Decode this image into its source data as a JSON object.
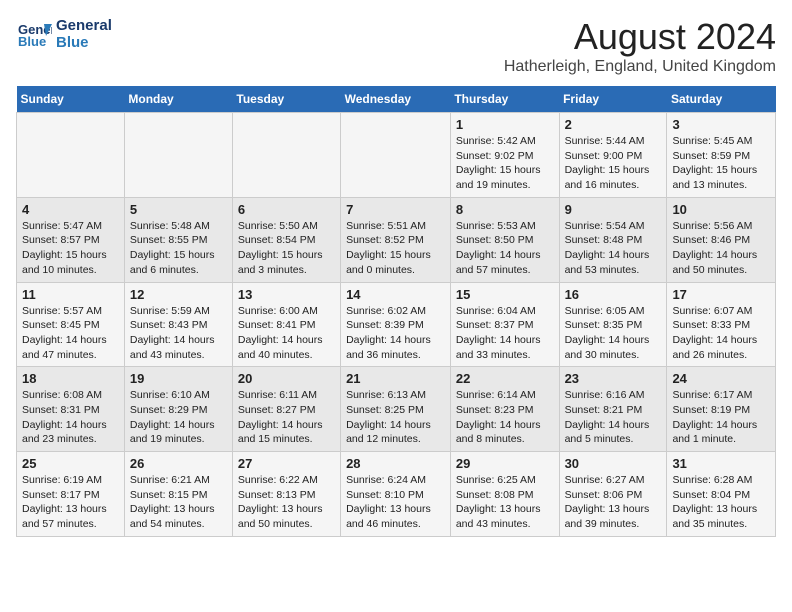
{
  "header": {
    "logo_line1": "General",
    "logo_line2": "Blue",
    "month": "August 2024",
    "location": "Hatherleigh, England, United Kingdom"
  },
  "days_of_week": [
    "Sunday",
    "Monday",
    "Tuesday",
    "Wednesday",
    "Thursday",
    "Friday",
    "Saturday"
  ],
  "weeks": [
    [
      {
        "day": "",
        "info": ""
      },
      {
        "day": "",
        "info": ""
      },
      {
        "day": "",
        "info": ""
      },
      {
        "day": "",
        "info": ""
      },
      {
        "day": "1",
        "info": "Sunrise: 5:42 AM\nSunset: 9:02 PM\nDaylight: 15 hours\nand 19 minutes."
      },
      {
        "day": "2",
        "info": "Sunrise: 5:44 AM\nSunset: 9:00 PM\nDaylight: 15 hours\nand 16 minutes."
      },
      {
        "day": "3",
        "info": "Sunrise: 5:45 AM\nSunset: 8:59 PM\nDaylight: 15 hours\nand 13 minutes."
      }
    ],
    [
      {
        "day": "4",
        "info": "Sunrise: 5:47 AM\nSunset: 8:57 PM\nDaylight: 15 hours\nand 10 minutes."
      },
      {
        "day": "5",
        "info": "Sunrise: 5:48 AM\nSunset: 8:55 PM\nDaylight: 15 hours\nand 6 minutes."
      },
      {
        "day": "6",
        "info": "Sunrise: 5:50 AM\nSunset: 8:54 PM\nDaylight: 15 hours\nand 3 minutes."
      },
      {
        "day": "7",
        "info": "Sunrise: 5:51 AM\nSunset: 8:52 PM\nDaylight: 15 hours\nand 0 minutes."
      },
      {
        "day": "8",
        "info": "Sunrise: 5:53 AM\nSunset: 8:50 PM\nDaylight: 14 hours\nand 57 minutes."
      },
      {
        "day": "9",
        "info": "Sunrise: 5:54 AM\nSunset: 8:48 PM\nDaylight: 14 hours\nand 53 minutes."
      },
      {
        "day": "10",
        "info": "Sunrise: 5:56 AM\nSunset: 8:46 PM\nDaylight: 14 hours\nand 50 minutes."
      }
    ],
    [
      {
        "day": "11",
        "info": "Sunrise: 5:57 AM\nSunset: 8:45 PM\nDaylight: 14 hours\nand 47 minutes."
      },
      {
        "day": "12",
        "info": "Sunrise: 5:59 AM\nSunset: 8:43 PM\nDaylight: 14 hours\nand 43 minutes."
      },
      {
        "day": "13",
        "info": "Sunrise: 6:00 AM\nSunset: 8:41 PM\nDaylight: 14 hours\nand 40 minutes."
      },
      {
        "day": "14",
        "info": "Sunrise: 6:02 AM\nSunset: 8:39 PM\nDaylight: 14 hours\nand 36 minutes."
      },
      {
        "day": "15",
        "info": "Sunrise: 6:04 AM\nSunset: 8:37 PM\nDaylight: 14 hours\nand 33 minutes."
      },
      {
        "day": "16",
        "info": "Sunrise: 6:05 AM\nSunset: 8:35 PM\nDaylight: 14 hours\nand 30 minutes."
      },
      {
        "day": "17",
        "info": "Sunrise: 6:07 AM\nSunset: 8:33 PM\nDaylight: 14 hours\nand 26 minutes."
      }
    ],
    [
      {
        "day": "18",
        "info": "Sunrise: 6:08 AM\nSunset: 8:31 PM\nDaylight: 14 hours\nand 23 minutes."
      },
      {
        "day": "19",
        "info": "Sunrise: 6:10 AM\nSunset: 8:29 PM\nDaylight: 14 hours\nand 19 minutes."
      },
      {
        "day": "20",
        "info": "Sunrise: 6:11 AM\nSunset: 8:27 PM\nDaylight: 14 hours\nand 15 minutes."
      },
      {
        "day": "21",
        "info": "Sunrise: 6:13 AM\nSunset: 8:25 PM\nDaylight: 14 hours\nand 12 minutes."
      },
      {
        "day": "22",
        "info": "Sunrise: 6:14 AM\nSunset: 8:23 PM\nDaylight: 14 hours\nand 8 minutes."
      },
      {
        "day": "23",
        "info": "Sunrise: 6:16 AM\nSunset: 8:21 PM\nDaylight: 14 hours\nand 5 minutes."
      },
      {
        "day": "24",
        "info": "Sunrise: 6:17 AM\nSunset: 8:19 PM\nDaylight: 14 hours\nand 1 minute."
      }
    ],
    [
      {
        "day": "25",
        "info": "Sunrise: 6:19 AM\nSunset: 8:17 PM\nDaylight: 13 hours\nand 57 minutes."
      },
      {
        "day": "26",
        "info": "Sunrise: 6:21 AM\nSunset: 8:15 PM\nDaylight: 13 hours\nand 54 minutes."
      },
      {
        "day": "27",
        "info": "Sunrise: 6:22 AM\nSunset: 8:13 PM\nDaylight: 13 hours\nand 50 minutes."
      },
      {
        "day": "28",
        "info": "Sunrise: 6:24 AM\nSunset: 8:10 PM\nDaylight: 13 hours\nand 46 minutes."
      },
      {
        "day": "29",
        "info": "Sunrise: 6:25 AM\nSunset: 8:08 PM\nDaylight: 13 hours\nand 43 minutes."
      },
      {
        "day": "30",
        "info": "Sunrise: 6:27 AM\nSunset: 8:06 PM\nDaylight: 13 hours\nand 39 minutes."
      },
      {
        "day": "31",
        "info": "Sunrise: 6:28 AM\nSunset: 8:04 PM\nDaylight: 13 hours\nand 35 minutes."
      }
    ]
  ]
}
